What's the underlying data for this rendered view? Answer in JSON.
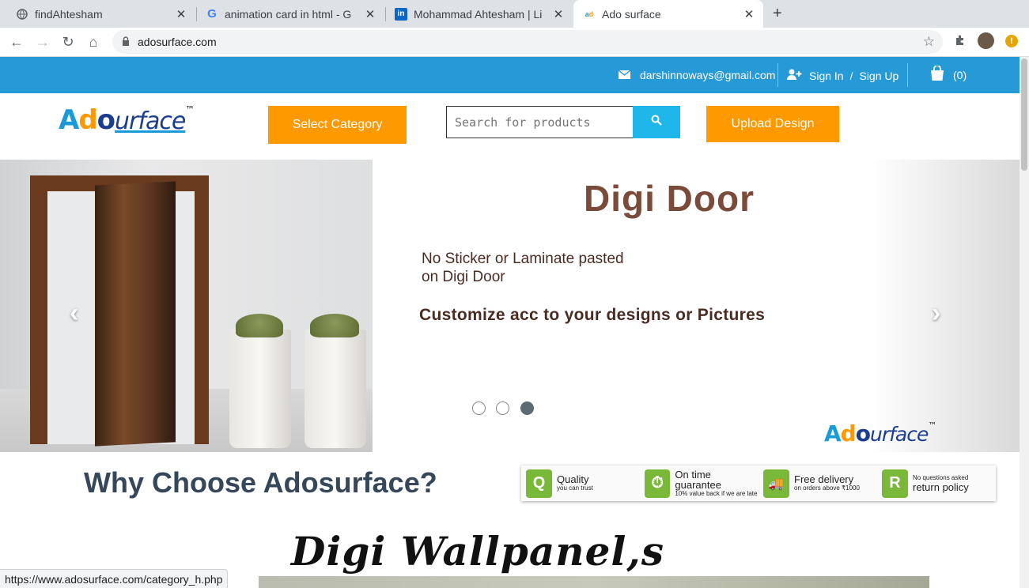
{
  "browser": {
    "tabs": [
      {
        "title": "findAhtesham",
        "favicon": "globe-icon"
      },
      {
        "title": "animation card in html - G",
        "favicon": "google-icon"
      },
      {
        "title": "Mohammad Ahtesham | Li",
        "favicon": "linkedin-icon"
      },
      {
        "title": "Ado surface",
        "favicon": "adosurface-icon",
        "active": true
      }
    ],
    "url": "adosurface.com",
    "status_url": "https://www.adosurface.com/category_h.php"
  },
  "topbar": {
    "email": "darshinnoways@gmail.com",
    "sign_in": "Sign In",
    "separator": "/",
    "sign_up": "Sign Up",
    "cart_count": "(0)",
    "color": "#259ad7"
  },
  "header": {
    "logo": {
      "a": "A",
      "d": "d",
      "o": "o",
      "rest": "urface",
      "tm": "™"
    },
    "select_category": "Select Category",
    "search_placeholder": "Search for products",
    "upload_design": "Upload Design",
    "accent": "#fe9a00"
  },
  "slider": {
    "title": "Digi Door",
    "subtitle_line1": "No Sticker or Laminate pasted",
    "subtitle_line2": "on Digi Door",
    "customize": "Customize acc to your designs or Pictures",
    "prev": "‹",
    "next": "›",
    "active_dot": 3
  },
  "why": {
    "heading": "Why Choose Adosurface?",
    "badges": [
      {
        "icon": "Q",
        "title": "Quality",
        "sub": "you can trust"
      },
      {
        "icon": "⏱",
        "title": "On time guarantee",
        "sub": "10% value back if we are late"
      },
      {
        "icon": "🚚",
        "title": "Free delivery",
        "sub": "on orders above ₹1000"
      },
      {
        "icon": "R",
        "title": "return policy",
        "sub": "No questions asked"
      }
    ]
  },
  "wall": {
    "title": "Digi Wallpanel,s"
  }
}
